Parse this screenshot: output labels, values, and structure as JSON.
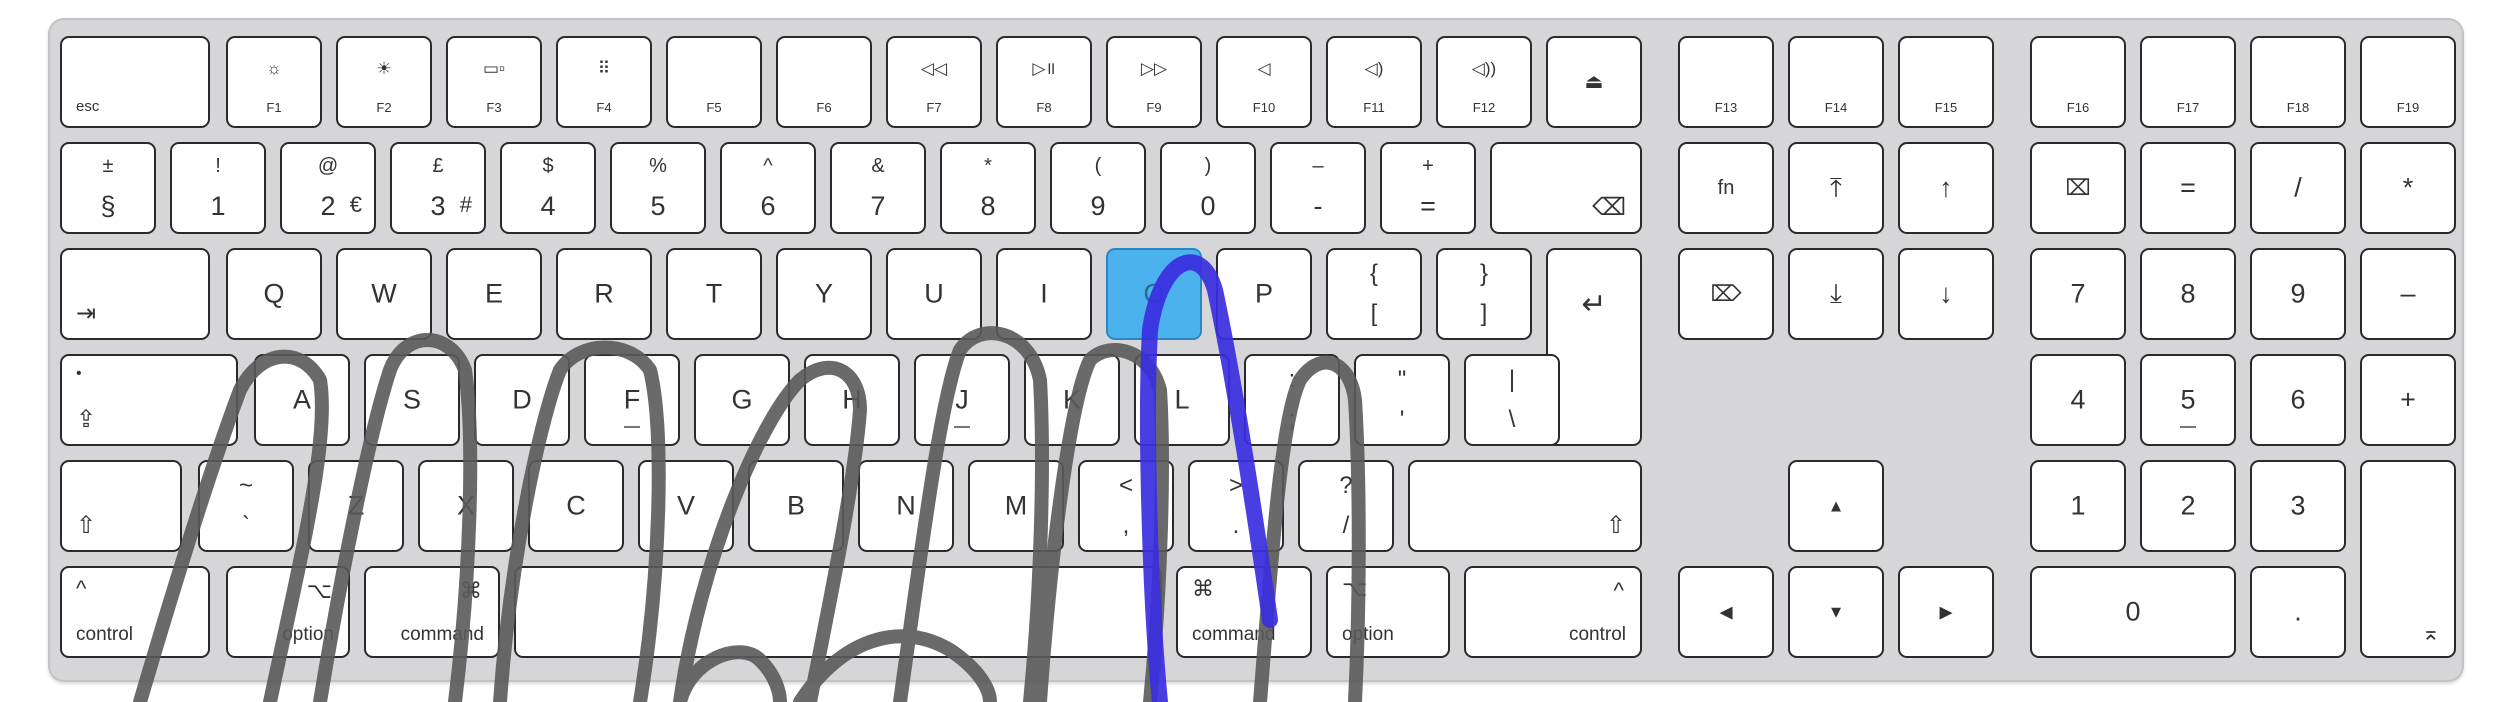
{
  "keyboard": {
    "function_row": [
      {
        "id": "esc",
        "label": "esc"
      },
      {
        "id": "f1",
        "label": "F1",
        "icon": "brightness-down-icon",
        "glyph": "☼"
      },
      {
        "id": "f2",
        "label": "F2",
        "icon": "brightness-up-icon",
        "glyph": "☀"
      },
      {
        "id": "f3",
        "label": "F3",
        "icon": "mission-control-icon",
        "glyph": "▭▫"
      },
      {
        "id": "f4",
        "label": "F4",
        "icon": "launchpad-icon",
        "glyph": "⠿"
      },
      {
        "id": "f5",
        "label": "F5"
      },
      {
        "id": "f6",
        "label": "F6"
      },
      {
        "id": "f7",
        "label": "F7",
        "icon": "rewind-icon",
        "glyph": "◁◁"
      },
      {
        "id": "f8",
        "label": "F8",
        "icon": "play-pause-icon",
        "glyph": "▷॥"
      },
      {
        "id": "f9",
        "label": "F9",
        "icon": "fast-forward-icon",
        "glyph": "▷▷"
      },
      {
        "id": "f10",
        "label": "F10",
        "icon": "mute-icon",
        "glyph": "◁"
      },
      {
        "id": "f11",
        "label": "F11",
        "icon": "volume-down-icon",
        "glyph": "◁)"
      },
      {
        "id": "f12",
        "label": "F12",
        "icon": "volume-up-icon",
        "glyph": "◁))"
      },
      {
        "id": "eject",
        "icon": "eject-icon",
        "glyph": "⏏"
      },
      {
        "id": "f13",
        "label": "F13"
      },
      {
        "id": "f14",
        "label": "F14"
      },
      {
        "id": "f15",
        "label": "F15"
      },
      {
        "id": "f16",
        "label": "F16"
      },
      {
        "id": "f17",
        "label": "F17"
      },
      {
        "id": "f18",
        "label": "F18"
      },
      {
        "id": "f19",
        "label": "F19"
      }
    ],
    "number_row": [
      {
        "id": "section",
        "top": "±",
        "bottom": "§"
      },
      {
        "id": "1",
        "top": "!",
        "bottom": "1"
      },
      {
        "id": "2",
        "top": "@",
        "bottom": "2",
        "extra": "€"
      },
      {
        "id": "3",
        "top": "£",
        "bottom": "3",
        "extra": "#"
      },
      {
        "id": "4",
        "top": "$",
        "bottom": "4"
      },
      {
        "id": "5",
        "top": "%",
        "bottom": "5"
      },
      {
        "id": "6",
        "top": "^",
        "bottom": "6"
      },
      {
        "id": "7",
        "top": "&",
        "bottom": "7"
      },
      {
        "id": "8",
        "top": "*",
        "bottom": "8"
      },
      {
        "id": "9",
        "top": "(",
        "bottom": "9"
      },
      {
        "id": "0",
        "top": ")",
        "bottom": "0"
      },
      {
        "id": "minus",
        "top": "–",
        "bottom": "-"
      },
      {
        "id": "equals",
        "top": "+",
        "bottom": "="
      },
      {
        "id": "delete",
        "icon": "delete-icon",
        "glyph": "⌫"
      }
    ],
    "qwerty_row": [
      "Q",
      "W",
      "E",
      "R",
      "T",
      "Y",
      "U",
      "I",
      "O",
      "P"
    ],
    "bracket_keys": [
      {
        "top": "{",
        "bottom": "["
      },
      {
        "top": "}",
        "bottom": "]"
      }
    ],
    "home_row": [
      "A",
      "S",
      "D",
      "F",
      "G",
      "H",
      "J",
      "K",
      "L"
    ],
    "home_punct": [
      {
        "top": ":",
        "bottom": ";"
      },
      {
        "top": "\"",
        "bottom": "'"
      },
      {
        "top": "|",
        "bottom": "\\"
      }
    ],
    "bottom_letter_row": [
      "Z",
      "X",
      "C",
      "V",
      "B",
      "N",
      "M"
    ],
    "bottom_punct": [
      {
        "top": "~",
        "bottom": "`"
      },
      {
        "top": "<",
        "bottom": ","
      },
      {
        "top": ">",
        "bottom": "."
      },
      {
        "top": "?",
        "bottom": "/"
      }
    ],
    "modifiers": {
      "control_left": "control",
      "option_left": "option",
      "command_left": "command",
      "command_right": "command",
      "option_right": "option",
      "control_right": "control",
      "control_glyph": "^",
      "option_glyph": "⌥",
      "command_glyph": "⌘",
      "tab_glyph": "⇥",
      "caps_glyph": "⇪",
      "shift_glyph": "⇧",
      "return_glyph": "↵",
      "caps_dot": "•"
    },
    "nav_block": {
      "fn": "fn",
      "home_glyph": "⤒",
      "page_up_glyph": "↑",
      "forward_delete_glyph": "⌦",
      "end_glyph": "⤓",
      "page_down_glyph": "↓",
      "up_glyph": "▲",
      "left_glyph": "◀",
      "down_glyph": "▼",
      "right_glyph": "▶"
    },
    "numpad": {
      "clear_glyph": "⌧",
      "row0": [
        "=",
        "/",
        "*"
      ],
      "row1": [
        "7",
        "8",
        "9",
        "–"
      ],
      "row2": [
        "4",
        "5",
        "6",
        "+"
      ],
      "row3": [
        "1",
        "2",
        "3"
      ],
      "zero": "0",
      "dot": ".",
      "enter_glyph": "⌅"
    },
    "highlighted_key": "O",
    "colors": {
      "highlight": "#4cb2ee",
      "finger_outline": "#5a5a5a",
      "pointer_finger": "#3a2ee0"
    }
  }
}
